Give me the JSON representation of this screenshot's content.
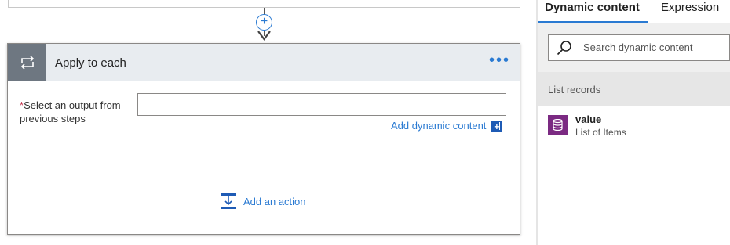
{
  "card": {
    "title": "Apply to each",
    "menu_label": "•••",
    "field_label": "Select an output from previous steps",
    "field_value": "",
    "required_marker": "*",
    "add_dynamic_label": "Add dynamic content",
    "add_dynamic_glyph": "+",
    "add_action_label": "Add an action",
    "icon": "loop-icon"
  },
  "connector": {
    "insert_glyph": "+"
  },
  "panel": {
    "tabs": [
      {
        "label": "Dynamic content",
        "active": true
      },
      {
        "label": "Expression",
        "active": false
      }
    ],
    "search": {
      "placeholder": "Search dynamic content",
      "value": ""
    },
    "section_header": "List records",
    "items": [
      {
        "name": "value",
        "description": "List of Items",
        "icon": "database-icon",
        "icon_color": "#7b2a82"
      }
    ]
  },
  "colors": {
    "accent": "#2a7ad2",
    "header_bg": "#e8ecf0",
    "icon_box": "#6e7781",
    "required": "#c4314b"
  }
}
